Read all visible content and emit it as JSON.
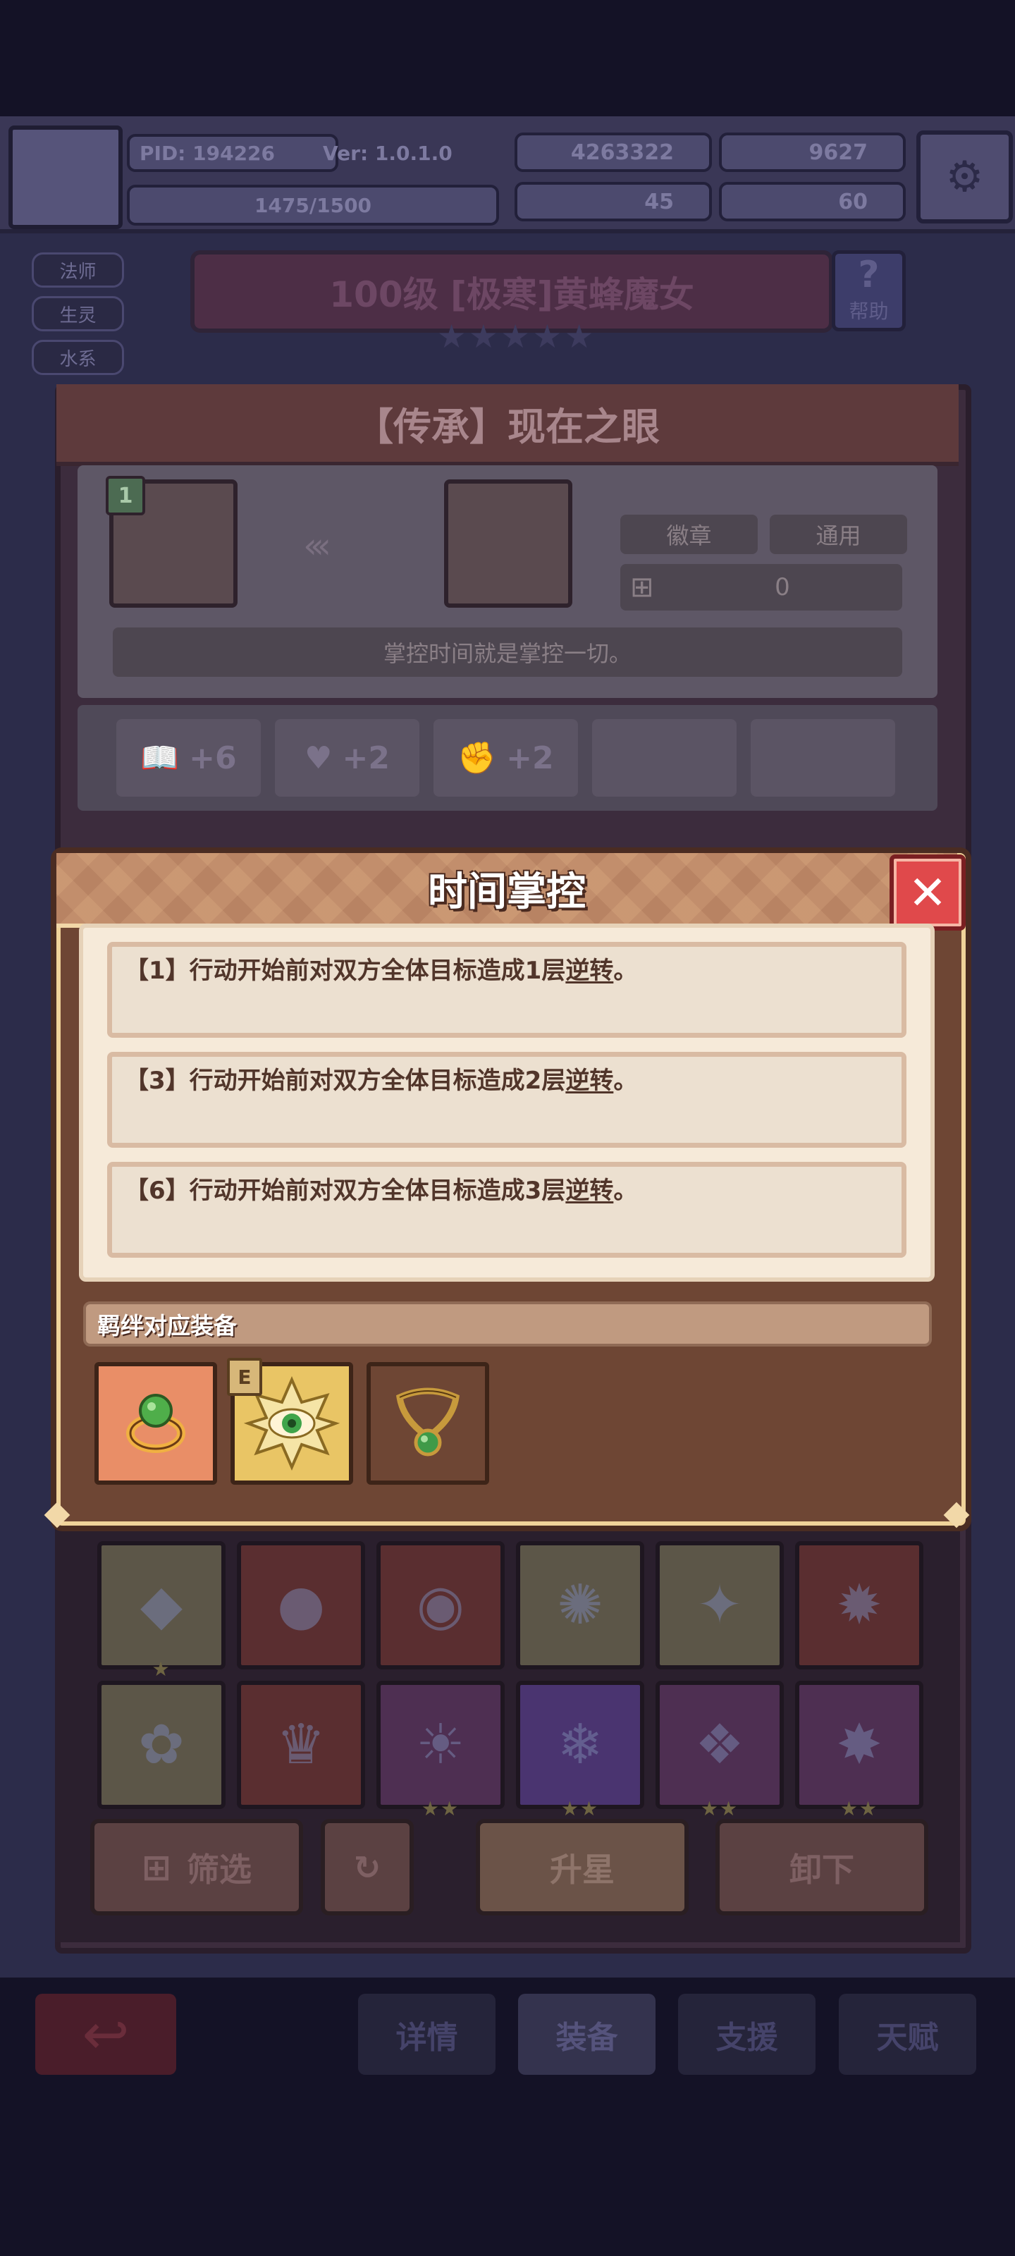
{
  "topbar": {
    "pid": "PID: 194226",
    "version": "Ver: 1.0.1.0",
    "gold": "4263322",
    "gems": "9627",
    "exp": "1475/1500",
    "res_a": "45",
    "res_b": "60"
  },
  "side_tags": [
    "法师",
    "生灵",
    "水系"
  ],
  "hero_title": "100级 [极寒]黄蜂魔女",
  "help_label": "帮助",
  "hero_stars": "★★★★★",
  "item_panel": {
    "title": "【传承】现在之眼",
    "level_badge": "1",
    "tag_badge": "徽章",
    "tag_common": "通用",
    "count": "0",
    "motto": "掌控时间就是掌控一切。",
    "stats": [
      {
        "icon": "book-icon",
        "value": "+6"
      },
      {
        "icon": "heart-icon",
        "value": "+2"
      },
      {
        "icon": "glove-icon",
        "value": "+2"
      }
    ]
  },
  "dialog": {
    "title": "时间掌控",
    "close_symbol": "✕",
    "entries": [
      {
        "prefix": "【1】行动开始前对双方全体目标造成1层",
        "keyword": "逆转",
        "suffix": "。"
      },
      {
        "prefix": "【3】行动开始前对双方全体目标造成2层",
        "keyword": "逆转",
        "suffix": "。"
      },
      {
        "prefix": "【6】行动开始前对双方全体目标造成3层",
        "keyword": "逆转",
        "suffix": "。"
      }
    ],
    "bond_label": "羁绊对应装备",
    "equipped_badge": "E",
    "bond_items": [
      {
        "name": "green-ring-icon",
        "bg": "#e98e67"
      },
      {
        "name": "eye-badge-icon",
        "bg": "#e9c565"
      },
      {
        "name": "emerald-necklace-icon",
        "bg": "#6e4634"
      }
    ]
  },
  "grid": {
    "row1": [
      {
        "name": "blue-crystal-icon",
        "bg": "#5c5648",
        "stars": "★"
      },
      {
        "name": "dark-orb-icon",
        "bg": "#5a2e30",
        "stars": ""
      },
      {
        "name": "dark-ring-icon",
        "bg": "#5a2e30",
        "stars": ""
      },
      {
        "name": "brown-badge-icon",
        "bg": "#5c5648",
        "stars": ""
      },
      {
        "name": "gold-badge-icon",
        "bg": "#5c5648",
        "stars": ""
      },
      {
        "name": "swirl-badge-icon",
        "bg": "#5a2e30",
        "stars": ""
      }
    ],
    "row2": [
      {
        "name": "blue-flower-icon",
        "bg": "#5c5648",
        "stars": ""
      },
      {
        "name": "crown-icon",
        "bg": "#5a2e30",
        "stars": ""
      },
      {
        "name": "sun-badge-icon",
        "bg": "#4e2f52",
        "stars": "★★"
      },
      {
        "name": "snowflake-icon",
        "bg": "#4a3470",
        "stars": "★★"
      },
      {
        "name": "diamond-badge-icon",
        "bg": "#4e2f52",
        "stars": "★★"
      },
      {
        "name": "red-gem-badge-icon",
        "bg": "#4e2f52",
        "stars": "★★"
      }
    ]
  },
  "buttons": {
    "filter": "筛选",
    "upgrade": "升星",
    "unequip": "卸下"
  },
  "nav": {
    "details": "详情",
    "equipment": "装备",
    "support": "支援",
    "talent": "天赋"
  },
  "colors": {
    "dialog_border": "#f0d39a",
    "dialog_header": "#b88363",
    "close_red": "#e0494b",
    "desc_bg": "#f6ead9"
  }
}
